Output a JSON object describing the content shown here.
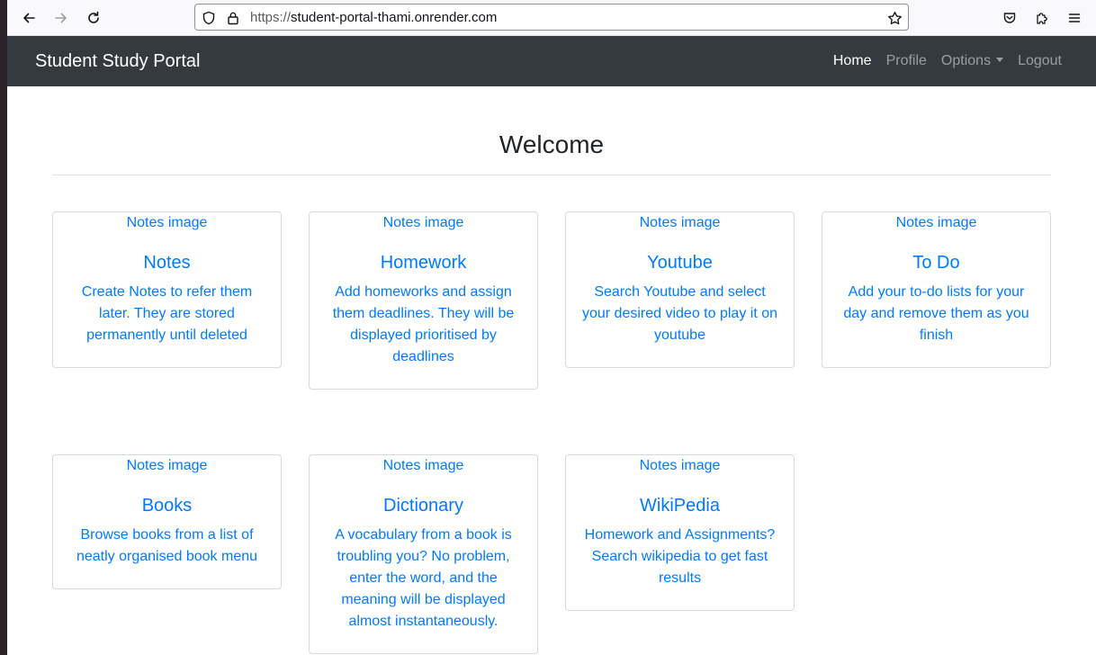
{
  "browser": {
    "url_scheme": "https://",
    "url_host": "student-portal-thami.onrender.com",
    "back_icon": "arrow-left-icon",
    "forward_icon": "arrow-right-icon",
    "reload_icon": "reload-icon",
    "bookmark_icon": "star-icon",
    "pocket_icon": "pocket-icon",
    "extensions_icon": "puzzle-icon",
    "menu_icon": "hamburger-icon"
  },
  "navbar": {
    "brand": "Student Study Portal",
    "links": {
      "home": "Home",
      "profile": "Profile",
      "options": "Options",
      "logout": "Logout"
    },
    "bg_color": "#343a40"
  },
  "main": {
    "heading": "Welcome",
    "cards": [
      {
        "image_alt": "Notes image",
        "title": "Notes",
        "text": "Create Notes to refer them later. They are stored permanently until deleted"
      },
      {
        "image_alt": "Notes image",
        "title": "Homework",
        "text": "Add homeworks and assign them deadlines. They will be displayed prioritised by deadlines"
      },
      {
        "image_alt": "Notes image",
        "title": "Youtube",
        "text": "Search Youtube and select your desired video to play it on youtube"
      },
      {
        "image_alt": "Notes image",
        "title": "To Do",
        "text": "Add your to-do lists for your day and remove them as you finish"
      },
      {
        "image_alt": "Notes image",
        "title": "Books",
        "text": "Browse books from a list of neatly organised book menu"
      },
      {
        "image_alt": "Notes image",
        "title": "Dictionary",
        "text": "A vocabulary from a book is troubling you? No problem, enter the word, and the meaning will be displayed almost instantaneously."
      },
      {
        "image_alt": "Notes image",
        "title": "WikiPedia",
        "text": "Homework and Assignments? Search wikipedia to get fast results"
      }
    ],
    "link_color": "#007bff"
  }
}
